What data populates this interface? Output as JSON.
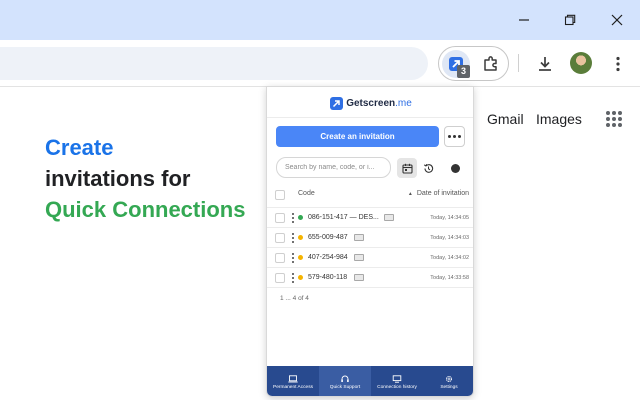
{
  "browser": {
    "extension_badge": "3",
    "colors": {
      "titlebar": "#d3e3fd",
      "omnibox": "#eef2f8"
    }
  },
  "promo": {
    "line1": "Create",
    "line2": "invitations for",
    "line3": "Quick Connections",
    "colors": {
      "line1": "#1a73e8",
      "line2": "#202124",
      "line3": "#34a853"
    }
  },
  "google_links": {
    "gmail": "Gmail",
    "images": "Images"
  },
  "popup": {
    "brand": {
      "name": "Getscreen",
      "suffix": ".me"
    },
    "create_button": "Create an invitation",
    "search_placeholder": "Search by name, code, or i...",
    "table": {
      "columns": {
        "code": "Code",
        "date": "Date of invitation"
      },
      "rows": [
        {
          "code": "086-151-417 — DES...",
          "date": "Today, 14:34:05",
          "status_color": "#34a853"
        },
        {
          "code": "655-009-487",
          "date": "Today, 14:34:03",
          "status_color": "#f5b400"
        },
        {
          "code": "407-254-984",
          "date": "Today, 14:34:02",
          "status_color": "#f5b400"
        },
        {
          "code": "579-480-118",
          "date": "Today, 14:33:58",
          "status_color": "#f5b400"
        }
      ]
    },
    "pager": "1 ... 4 of 4",
    "nav": [
      {
        "label": "Permanent Access",
        "icon": "laptop-icon"
      },
      {
        "label": "Quick Support",
        "icon": "support-icon"
      },
      {
        "label": "Connection history",
        "icon": "history-icon"
      },
      {
        "label": "Settings",
        "icon": "gear-icon"
      }
    ],
    "accent": "#4a86f7",
    "nav_color": "#284a8f"
  }
}
